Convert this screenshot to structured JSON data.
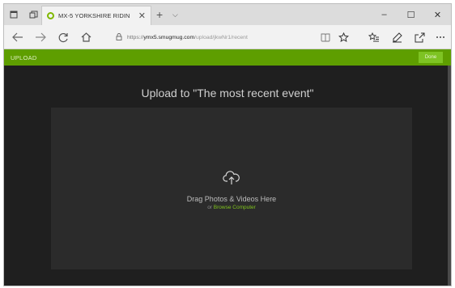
{
  "tab": {
    "title": "MX-5 YORKSHIRE RIDIN",
    "close": "✕",
    "new": "+",
    "list": "⌵"
  },
  "window": {
    "minimize": "–",
    "maximize": "☐",
    "close": "✕"
  },
  "address": {
    "prefix": "https://",
    "domain": "ymx5.smugmug.com",
    "path": "/upload/jkwNr1/recent"
  },
  "toolbar": {
    "upload_label": "UPLOAD",
    "done_label": "Done"
  },
  "main": {
    "heading": "Upload to \"The most recent event\"",
    "drag_text": "Drag Photos & Videos Here",
    "or_text": "or",
    "browse_text": "Browse Computer"
  },
  "colors": {
    "accent": "#5e9e00",
    "link": "#7fc31c",
    "background": "#1f1f1f",
    "dropzone": "#2b2b2b"
  },
  "icons": {
    "tab_actions": "tab-actions-icon",
    "tab_back": "tab-aside-icon",
    "favicon": "smugmug-favicon-icon",
    "back": "back-arrow-icon",
    "forward": "forward-arrow-icon",
    "refresh": "refresh-icon",
    "home": "home-icon",
    "lock": "lock-icon",
    "reading_view": "reading-view-icon",
    "favorite": "star-icon",
    "favorites_hub": "favorites-hub-icon",
    "notes": "pen-icon",
    "share": "share-icon",
    "more": "more-icon",
    "upload": "cloud-upload-icon"
  }
}
